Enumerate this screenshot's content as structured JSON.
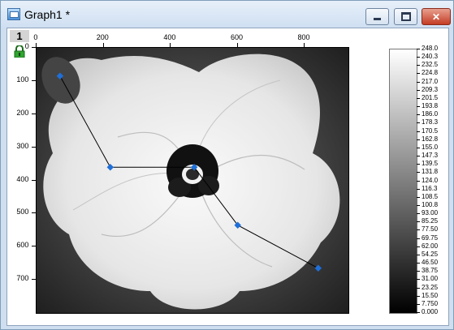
{
  "window": {
    "title": "Graph1 *",
    "icons": {
      "app": "graph-window-icon",
      "minimize": "minimize-icon",
      "maximize": "maximize-icon",
      "close": "close-icon",
      "lock": "lock-icon"
    }
  },
  "layer": {
    "number": "1"
  },
  "axes": {
    "x_ticks": [
      "0",
      "200",
      "400",
      "600",
      "800"
    ],
    "y_ticks": [
      "0",
      "100",
      "200",
      "300",
      "400",
      "500",
      "600",
      "700"
    ]
  },
  "colorbar": {
    "labels": [
      "248.0",
      "240.3",
      "232.5",
      "224.8",
      "217.0",
      "209.3",
      "201.5",
      "193.8",
      "186.0",
      "178.3",
      "170.5",
      "162.8",
      "155.0",
      "147.3",
      "139.5",
      "131.8",
      "124.0",
      "116.3",
      "108.5",
      "100.8",
      "93.00",
      "85.25",
      "77.50",
      "69.75",
      "62.00",
      "54.25",
      "46.50",
      "38.75",
      "31.00",
      "23.25",
      "15.50",
      "7.750",
      "0.000"
    ],
    "colors": {
      "top": "#ffffff",
      "bottom": "#000000"
    }
  },
  "chart_data": {
    "type": "line",
    "x": [
      70,
      220,
      470,
      600,
      840
    ],
    "y": [
      85,
      360,
      360,
      535,
      665
    ],
    "xlim": [
      0,
      930
    ],
    "ylim": [
      0,
      800
    ],
    "y_inverted": true,
    "line_color": "#000000",
    "marker_color": "#1e6fd9",
    "background": "grayscale flower image"
  }
}
